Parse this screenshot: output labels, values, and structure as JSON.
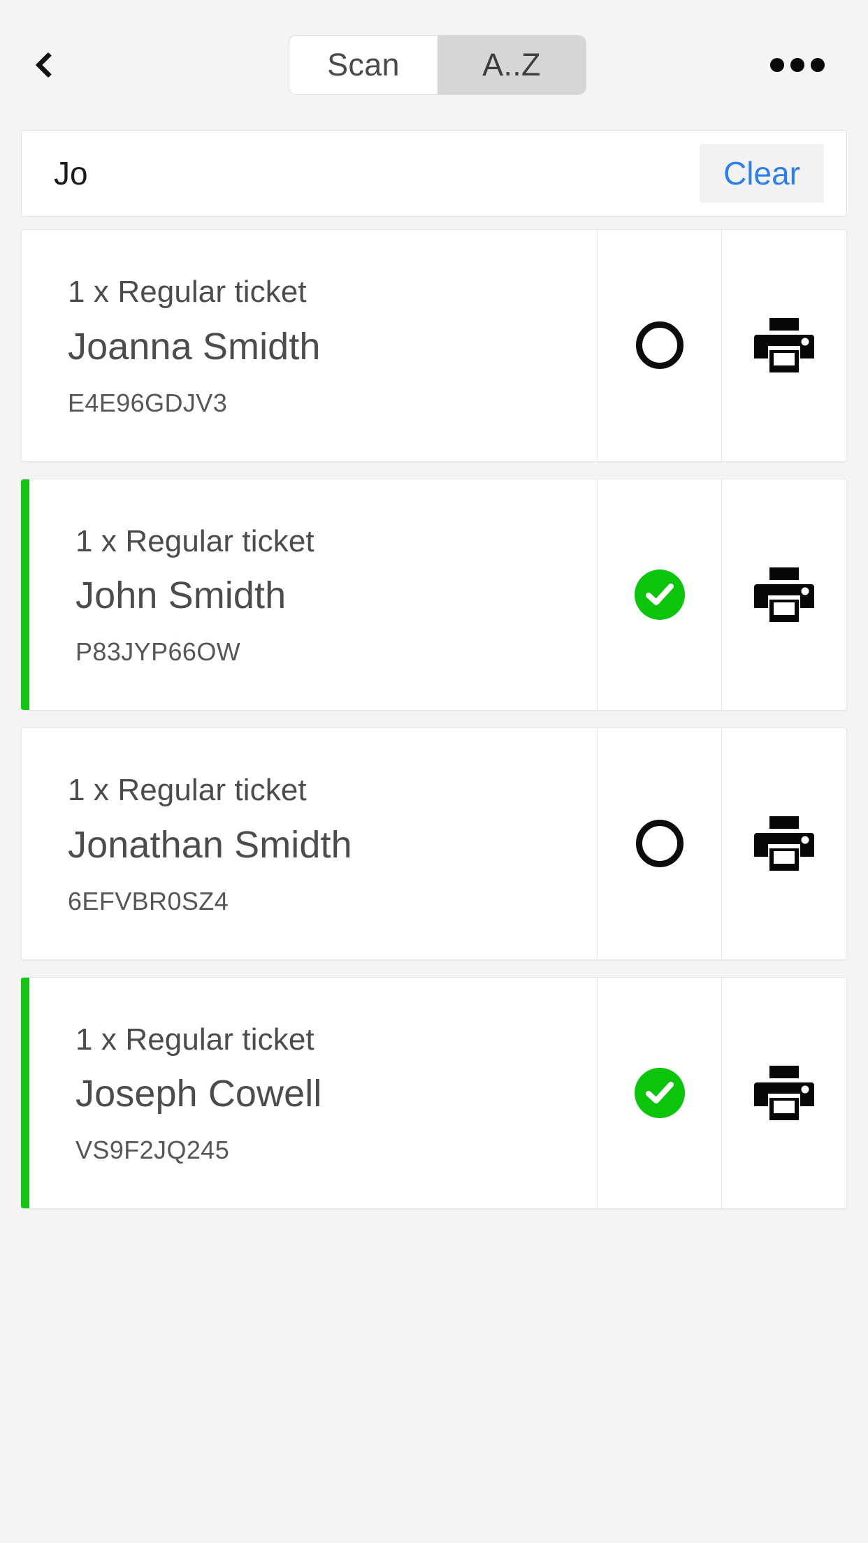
{
  "header": {
    "back_icon": "chevron-left-icon",
    "more_icon": "more-horizontal-icon",
    "segmented": {
      "options": [
        {
          "label": "Scan",
          "active": false
        },
        {
          "label": "A..Z",
          "active": true
        }
      ]
    }
  },
  "search": {
    "value": "Jo",
    "placeholder": "Search",
    "clear_label": "Clear"
  },
  "colors": {
    "accent_green": "#16c416",
    "check_green": "#0cc40c",
    "link_blue": "#2f7fe8",
    "page_background": "#f4f4f4",
    "card_background": "#ffffff",
    "text_primary": "#4c4c4c"
  },
  "list": {
    "items": [
      {
        "ticket": "1 x Regular ticket",
        "name": "Joanna Smidth",
        "code": "E4E96GDJV3",
        "checked_in": false,
        "status_icon": "circle-outline-icon",
        "print_icon": "printer-icon"
      },
      {
        "ticket": "1 x Regular ticket",
        "name": "John Smidth",
        "code": "P83JYP66OW",
        "checked_in": true,
        "status_icon": "check-circle-icon",
        "print_icon": "printer-icon"
      },
      {
        "ticket": "1 x Regular ticket",
        "name": "Jonathan Smidth",
        "code": "6EFVBR0SZ4",
        "checked_in": false,
        "status_icon": "circle-outline-icon",
        "print_icon": "printer-icon"
      },
      {
        "ticket": "1 x Regular ticket",
        "name": "Joseph Cowell",
        "code": "VS9F2JQ245",
        "checked_in": true,
        "status_icon": "check-circle-icon",
        "print_icon": "printer-icon"
      }
    ]
  }
}
